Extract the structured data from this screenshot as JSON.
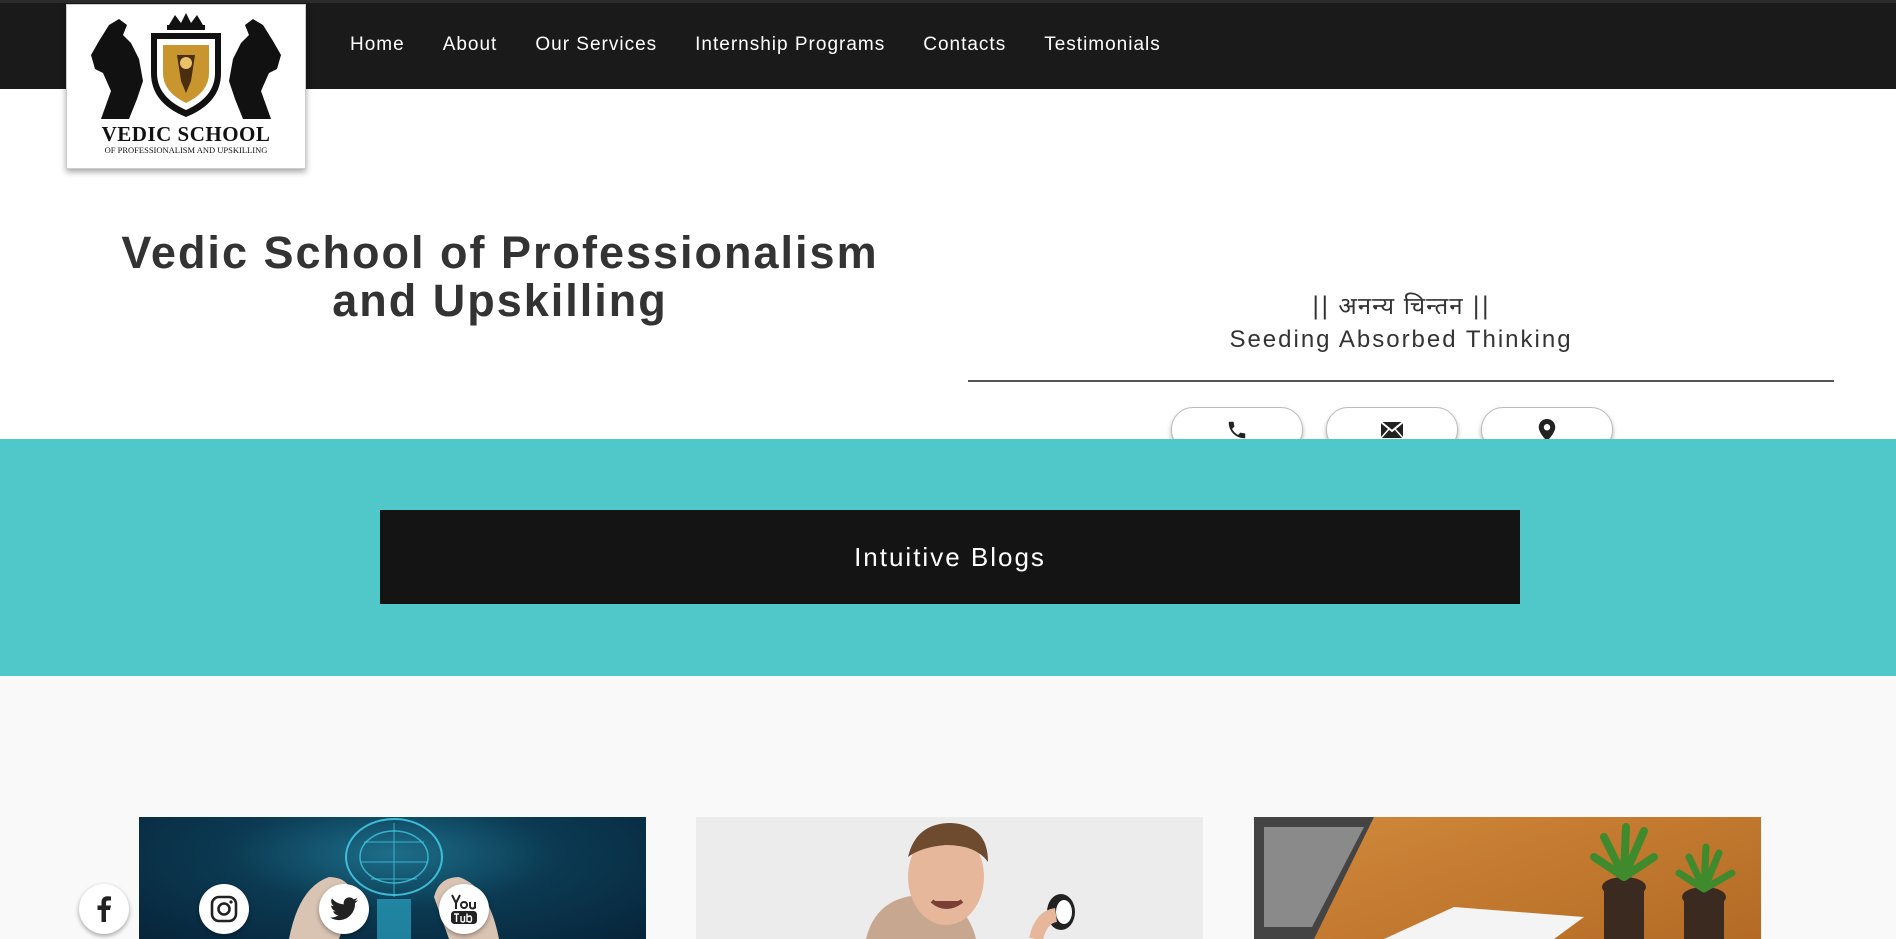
{
  "logo": {
    "title": "VEDIC SCHOOL",
    "subtitle": "OF PROFESSIONALISM AND UPSKILLING"
  },
  "nav": {
    "items": [
      {
        "label": "Home"
      },
      {
        "label": "About"
      },
      {
        "label": "Our Services"
      },
      {
        "label": "Internship Programs"
      },
      {
        "label": "Contacts"
      },
      {
        "label": "Testimonials"
      }
    ]
  },
  "header": {
    "site_title": "Vedic School of Professionalism and Upskilling",
    "motto_hindi": "|| अनन्य चिन्तन ||",
    "motto_english": "Seeding Absorbed Thinking",
    "contact_buttons": [
      {
        "icon": "phone-icon"
      },
      {
        "icon": "envelope-icon"
      },
      {
        "icon": "map-marker-icon"
      }
    ]
  },
  "blogs": {
    "banner_label": "Intuitive Blogs"
  },
  "social": [
    {
      "icon": "facebook-icon"
    },
    {
      "icon": "instagram-icon"
    },
    {
      "icon": "twitter-icon"
    },
    {
      "icon": "youtube-icon"
    }
  ],
  "colors": {
    "topbar": "#1a1a1a",
    "teal_band": "#50c7c8",
    "banner": "#141414"
  }
}
